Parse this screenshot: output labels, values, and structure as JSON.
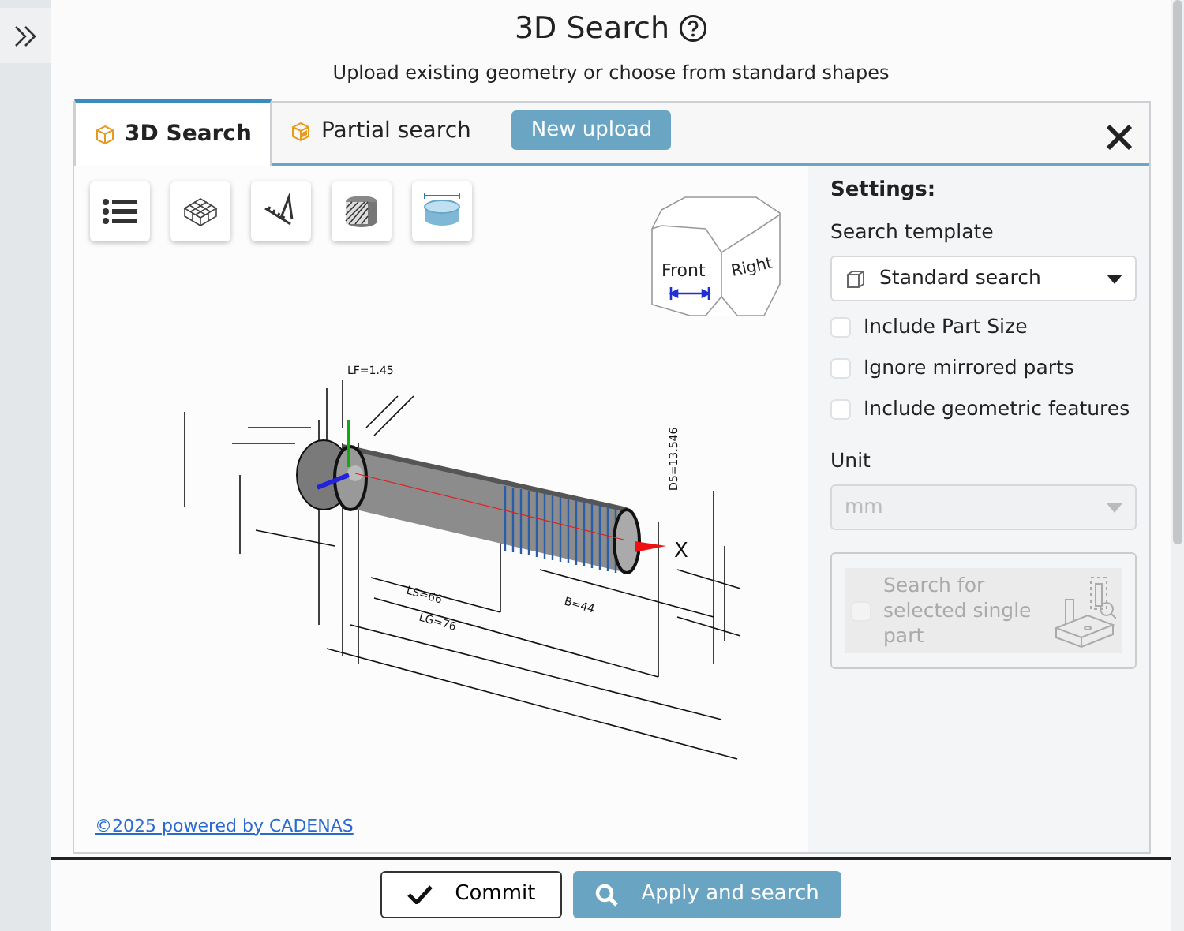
{
  "header": {
    "title": "3D Search",
    "subtitle": "Upload existing geometry or choose from standard shapes"
  },
  "tabs": [
    {
      "label": "3D Search",
      "selected": true
    },
    {
      "label": "Partial search",
      "selected": false
    }
  ],
  "new_upload_button": "New upload",
  "viewer": {
    "view_cube": {
      "faces": [
        "Front",
        "Right"
      ]
    },
    "dimension_labels": [
      {
        "text": "LF=1.45",
        "kind": "flat"
      },
      {
        "text": "D5=13.546",
        "kind": "vertical"
      },
      {
        "text": "LS=66",
        "kind": "slanted"
      },
      {
        "text": "LG=76",
        "kind": "slanted"
      },
      {
        "text": "B=44",
        "kind": "slanted"
      }
    ],
    "axis_label": "X"
  },
  "settings": {
    "heading": "Settings:",
    "template_label": "Search template",
    "template_value": "Standard search",
    "options": [
      {
        "label": "Include Part Size",
        "checked": false
      },
      {
        "label": "Ignore mirrored parts",
        "checked": false
      },
      {
        "label": "Include geometric features",
        "checked": false
      }
    ],
    "unit_label": "Unit",
    "unit_value": "mm",
    "unit_disabled": true,
    "single_part": {
      "label": "Search for selected single part",
      "checked": false,
      "disabled": true
    }
  },
  "footer_link": "©2025 powered by CADENAS",
  "buttons": [
    {
      "label": "Commit",
      "kind": "commit"
    },
    {
      "label": "Apply and search",
      "kind": "apply"
    }
  ]
}
